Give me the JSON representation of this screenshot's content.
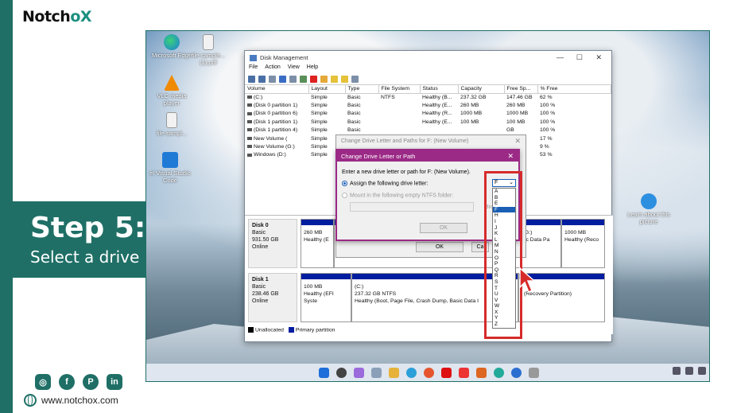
{
  "brand": {
    "prefix": "Notch",
    "o": "o",
    "x": "X"
  },
  "step": {
    "title": "Step 5:",
    "subtitle": "Select a drive letter"
  },
  "website": "www.notchox.com",
  "socials": [
    "instagram-icon",
    "facebook-icon",
    "pinterest-icon",
    "linkedin-icon"
  ],
  "desktop_icons": [
    {
      "label": "Microsoft Edge",
      "icon": "edge-icon"
    },
    {
      "label": "file-sample... (1).pdf",
      "icon": "pdf-icon"
    },
    {
      "label": "VLC media player",
      "icon": "vlc-icon"
    },
    {
      "label": "file-sampl...",
      "icon": "file-icon"
    },
    {
      "label": "el Visual Studio Code",
      "icon": "vscode-icon"
    },
    {
      "label": "Learn about this picture",
      "icon": "info-icon"
    }
  ],
  "disk_mgmt": {
    "title": "Disk Management",
    "menu": [
      "File",
      "Action",
      "View",
      "Help"
    ],
    "columns": [
      "Volume",
      "Layout",
      "Type",
      "File System",
      "Status",
      "Capacity",
      "Free Sp...",
      "% Free"
    ],
    "rows": [
      [
        "(C:)",
        "Simple",
        "Basic",
        "NTFS",
        "Healthy (B...",
        "237.32 GB",
        "147.46 GB",
        "62 %"
      ],
      [
        "(Disk 0 partition 1)",
        "Simple",
        "Basic",
        "",
        "Healthy (E...",
        "260 MB",
        "260 MB",
        "100 %"
      ],
      [
        "(Disk 0 partition 6)",
        "Simple",
        "Basic",
        "",
        "Healthy (R...",
        "1000 MB",
        "1000 MB",
        "100 %"
      ],
      [
        "(Disk 1 partition 1)",
        "Simple",
        "Basic",
        "",
        "Healthy (E...",
        "100 MB",
        "100 MB",
        "100 %"
      ],
      [
        "(Disk 1 partition 4)",
        "Simple",
        "Basic",
        "",
        "",
        "",
        "GB",
        "100 %"
      ],
      [
        "New Volume (",
        "Simple",
        "",
        "",
        "",
        "",
        "GB",
        "17 %"
      ],
      [
        "New Volume (G:)",
        "Simple",
        "",
        "",
        "",
        "",
        "GB",
        "9 %"
      ],
      [
        "Windows (D:)",
        "Simple",
        "",
        "",
        "",
        "",
        "GB",
        "53 %"
      ]
    ],
    "disk0": {
      "name": "Disk 0",
      "type": "Basic",
      "size": "931.50 GB",
      "status": "Online"
    },
    "disk0_parts": [
      {
        "size": "260 MB",
        "status": "Healthy (E"
      },
      {
        "name": "G:)",
        "status": "ic Data Pa"
      },
      {
        "size": "1000 MB",
        "status": "Healthy (Reco"
      }
    ],
    "disk1": {
      "name": "Disk 1",
      "type": "Basic",
      "size": "238.46 GB",
      "status": "Online"
    },
    "disk1_parts": [
      {
        "size": "100 MB",
        "status": "Healthy (EFI Syste"
      },
      {
        "name": "(C:)",
        "size": "237.32 GB NTFS",
        "status": "Healthy (Boot, Page File, Crash Dump, Basic Data I"
      },
      {
        "status": "(Recovery Partition)"
      }
    ],
    "legend": [
      "Unallocated",
      "Primary partition"
    ],
    "colors": {
      "unallocated": "#000000",
      "primary": "#001da0"
    }
  },
  "dialog_paths": {
    "title": "Change Drive Letter and Paths for F: (New Volume)",
    "ok": "OK",
    "ca_fragment": "Ca",
    "c_fragment": "C"
  },
  "dialog_letter": {
    "title": "Change Drive Letter or Path",
    "prompt": "Enter a new drive letter or path for F: (New Volume).",
    "opt_assign": "Assign the following drive letter:",
    "opt_mount": "Mount in the following empty NTFS folder:",
    "browse_fragment": "Bro",
    "ok": "OK"
  },
  "dropdown": {
    "selected": "F",
    "options": [
      "A",
      "B",
      "E",
      "F",
      "H",
      "I",
      "J",
      "K",
      "L",
      "M",
      "N",
      "O",
      "P",
      "Q",
      "R",
      "S",
      "T",
      "U",
      "V",
      "W",
      "X",
      "Y",
      "Z"
    ],
    "accent": "#1a5fb4",
    "highlight_color": "#d62b2b"
  }
}
